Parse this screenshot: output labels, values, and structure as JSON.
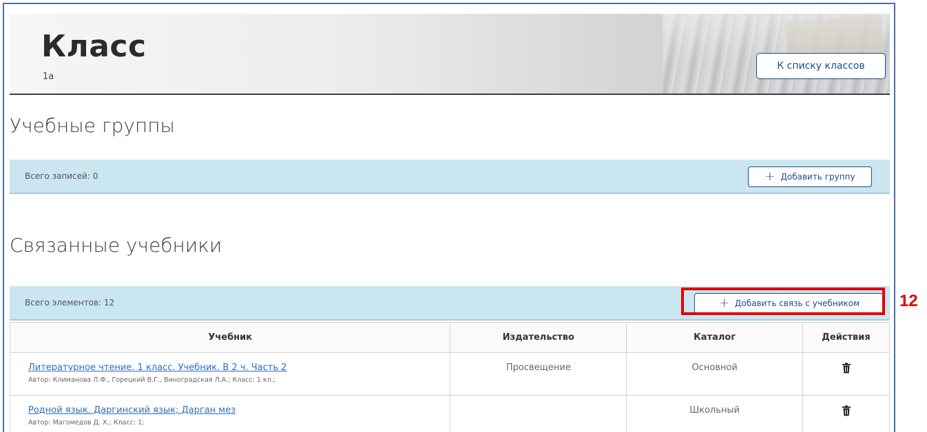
{
  "header": {
    "title": "Класс",
    "subtitle": "1а",
    "back_button": "К списку классов"
  },
  "groups": {
    "title": "Учебные группы",
    "count_text": "Всего записей: 0",
    "add_button": "Добавить группу"
  },
  "textbooks": {
    "title": "Связанные учебники",
    "count_text": "Всего элементов: 12",
    "add_button": "Добавить связь с учебником",
    "columns": [
      "Учебник",
      "Издательство",
      "Каталог",
      "Действия"
    ],
    "rows": [
      {
        "title": "Литературное чтение. 1 класс. Учебник. В 2 ч. Часть 2",
        "meta": "Автор: Климанова Л.Ф., Горецкий В.Г., Виноградская Л.А.; Класс: 1 кл.;",
        "publisher": "Просвещение",
        "catalog": "Основной"
      },
      {
        "title": "Родной язык. Даргинский язык; Дарган мез",
        "meta": "Автор: Магомедов Д. Х.; Класс: 1;",
        "publisher": "",
        "catalog": "Школьный"
      }
    ]
  },
  "annotation": {
    "label": "12",
    "color": "#e00000"
  },
  "colors": {
    "accent": "#1f4a8a",
    "bar_bg": "#c9e6f1",
    "link": "#2d6cc0"
  },
  "icons": {
    "plus": "plus-icon",
    "delete": "trash-icon"
  }
}
